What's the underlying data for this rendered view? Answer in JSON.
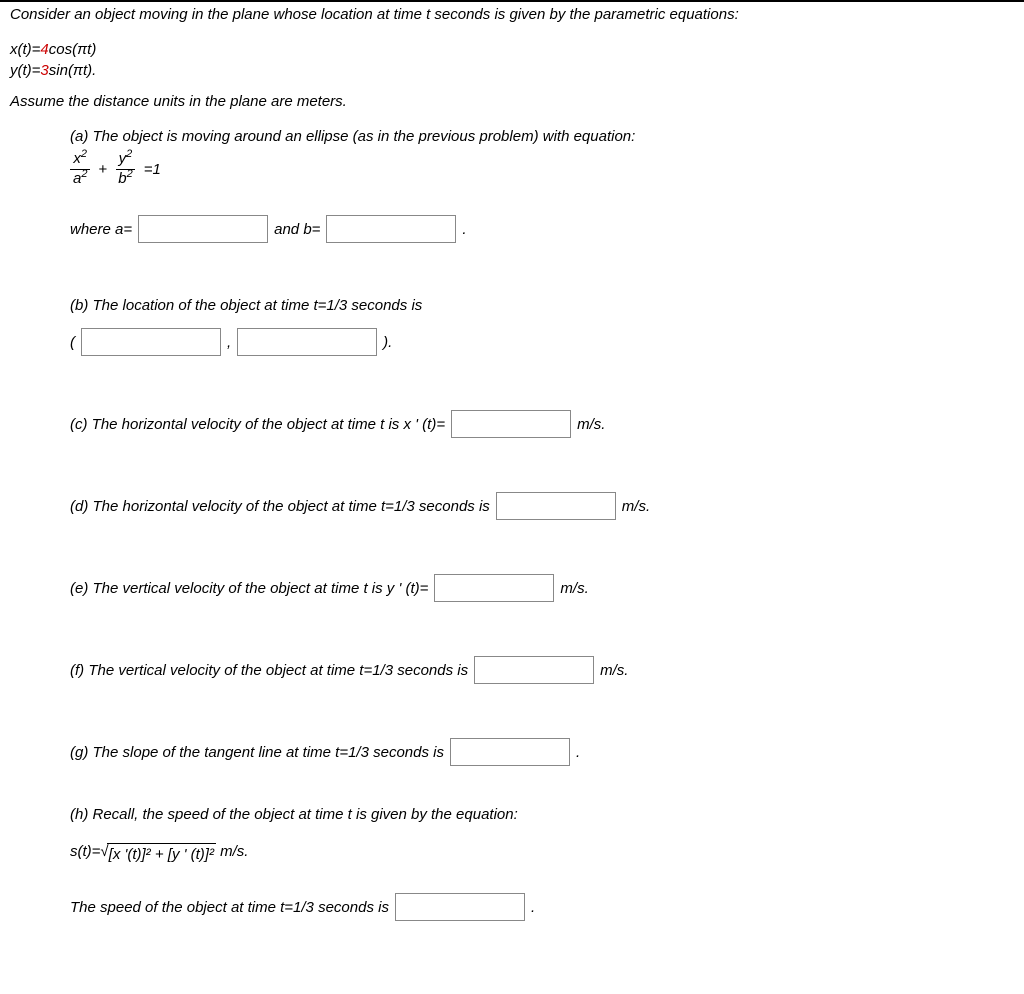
{
  "problem": {
    "intro": "Consider an object moving in the plane whose location at time t seconds is given by the parametric equations:",
    "xt_prefix": "x(t)=",
    "xt_coef": "4",
    "xt_suffix": "cos(πt)",
    "yt_prefix": "y(t)=",
    "yt_coef": "3",
    "yt_suffix": "sin(πt).",
    "assume": "Assume the distance units in the plane are meters.",
    "parts": {
      "a": {
        "label": "(a) The object is moving around an ellipse (as in the previous problem) with equation:",
        "where_a": "where a=",
        "and_b": "and b=",
        "eq_rhs": "=1",
        "period": "."
      },
      "b": {
        "label": "(b) The location of the object at time t=1/3 seconds is",
        "open": "(",
        "comma": ",",
        "close": ")."
      },
      "c": {
        "text": "(c) The horizontal velocity of the object at time t is x ' (t)=",
        "unit": "m/s."
      },
      "d": {
        "text": "(d) The horizontal velocity of the object at time t=1/3 seconds is",
        "unit": "m/s."
      },
      "e": {
        "text": "(e) The vertical velocity of the object at time t is y ' (t)=",
        "unit": "m/s."
      },
      "f": {
        "text": "(f) The vertical velocity of the object at time t=1/3 seconds is",
        "unit": "m/s."
      },
      "g": {
        "text": "(g) The slope of the tangent line at time t=1/3 seconds is",
        "period": "."
      },
      "h": {
        "label": "(h) Recall, the speed of the object at time t is given by the equation:",
        "eq_prefix": "s(t)=",
        "eq_body": "[x '(t)]² + [y ' (t)]²",
        "eq_suffix": " m/s.",
        "speed_prompt": "The speed of the object at time t=1/3 seconds is",
        "period": "."
      }
    }
  }
}
